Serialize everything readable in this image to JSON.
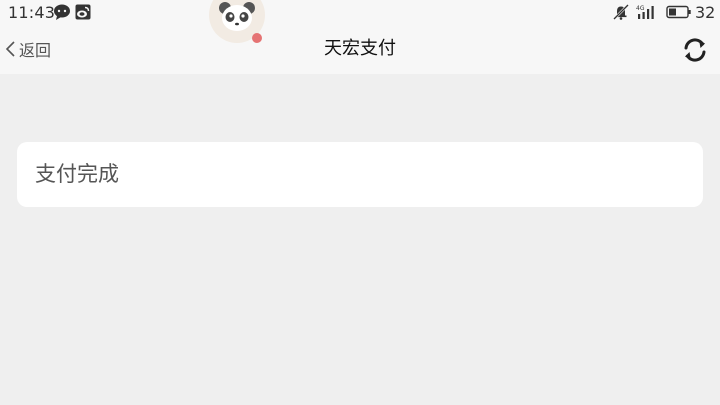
{
  "status_bar": {
    "time": "11:43",
    "battery_percent": "32",
    "icons": [
      "chat-bubble-icon",
      "weibo-icon",
      "mute-bell-icon",
      "4g-signal-icon",
      "battery-icon"
    ]
  },
  "nav": {
    "back_label": "返回",
    "title": "天宏支付",
    "refresh_icon": "refresh-icon"
  },
  "content": {
    "status_text": "支付完成"
  },
  "colors": {
    "background": "#efefef",
    "header": "#f7f7f7",
    "card": "#ffffff",
    "notification_dot": "#e57373"
  }
}
